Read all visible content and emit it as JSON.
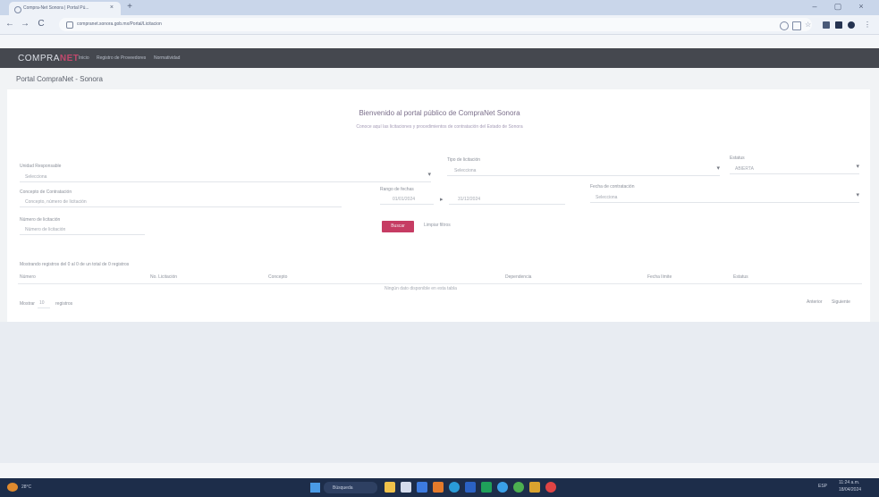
{
  "browser": {
    "tab_title": "Compra-Net Sonora | Portal Pú...",
    "tab_close": "×",
    "new_tab": "+",
    "url": "compranet.sonora.gob.mx/Portal/Licitacion",
    "back": "←",
    "forward": "→",
    "reload": "C",
    "minimize": "–",
    "maximize": "▢",
    "close": "×"
  },
  "site": {
    "logo_text": "COMPRA",
    "logo_accent": "NET",
    "nav_links": [
      "Inicio",
      "Registro de Proveedores",
      "Normatividad"
    ]
  },
  "page": {
    "title": "Portal CompraNet - Sonora",
    "heading": "Bienvenido al portal público de CompraNet Sonora",
    "subheading": "Conoce aquí las licitaciones y procedimientos de contratación del Estado de Sonora"
  },
  "filters": {
    "unidad_label": "Unidad Responsable",
    "unidad_value": "Selecciona",
    "tipo_label": "Tipo de licitación",
    "tipo_value": "Selecciona",
    "estatus_label": "Estatus",
    "estatus_value": "ABIERTA",
    "concepto_label": "Concepto de Contratación",
    "concepto_value": "Concepto, número de licitación",
    "rango_label": "Rango de fechas",
    "fecha_inicio": "01/01/2024",
    "fecha_fin": "31/12/2024",
    "fecha_label": "Fecha de contratación",
    "fecha_value": "Selecciona",
    "numero_label": "Número de licitación",
    "numero_value": "Número de licitación",
    "buscar": "Buscar",
    "limpiar": "Limpiar filtros"
  },
  "table": {
    "records_text": "Mostrando registros del 0 al 0 de un total de 0 registros",
    "headers": [
      "Número",
      "No. Licitación",
      "Concepto",
      "Dependencia",
      "Fecha límite",
      "Estatus"
    ],
    "empty_text": "Ningún dato disponible en esta tabla",
    "page_size_label": "Mostrar",
    "page_size_value": "10",
    "page_size_suffix": "registros",
    "prev": "Anterior",
    "next": "Siguiente"
  },
  "taskbar": {
    "weather": "28°C",
    "search": "Búsqueda",
    "time": "11:24 a.m.",
    "date": "18/04/2024",
    "lang": "ESP"
  },
  "colors": {
    "accent": "#c63c63",
    "header": "#45484f",
    "taskbar": "#1d2d4a"
  }
}
